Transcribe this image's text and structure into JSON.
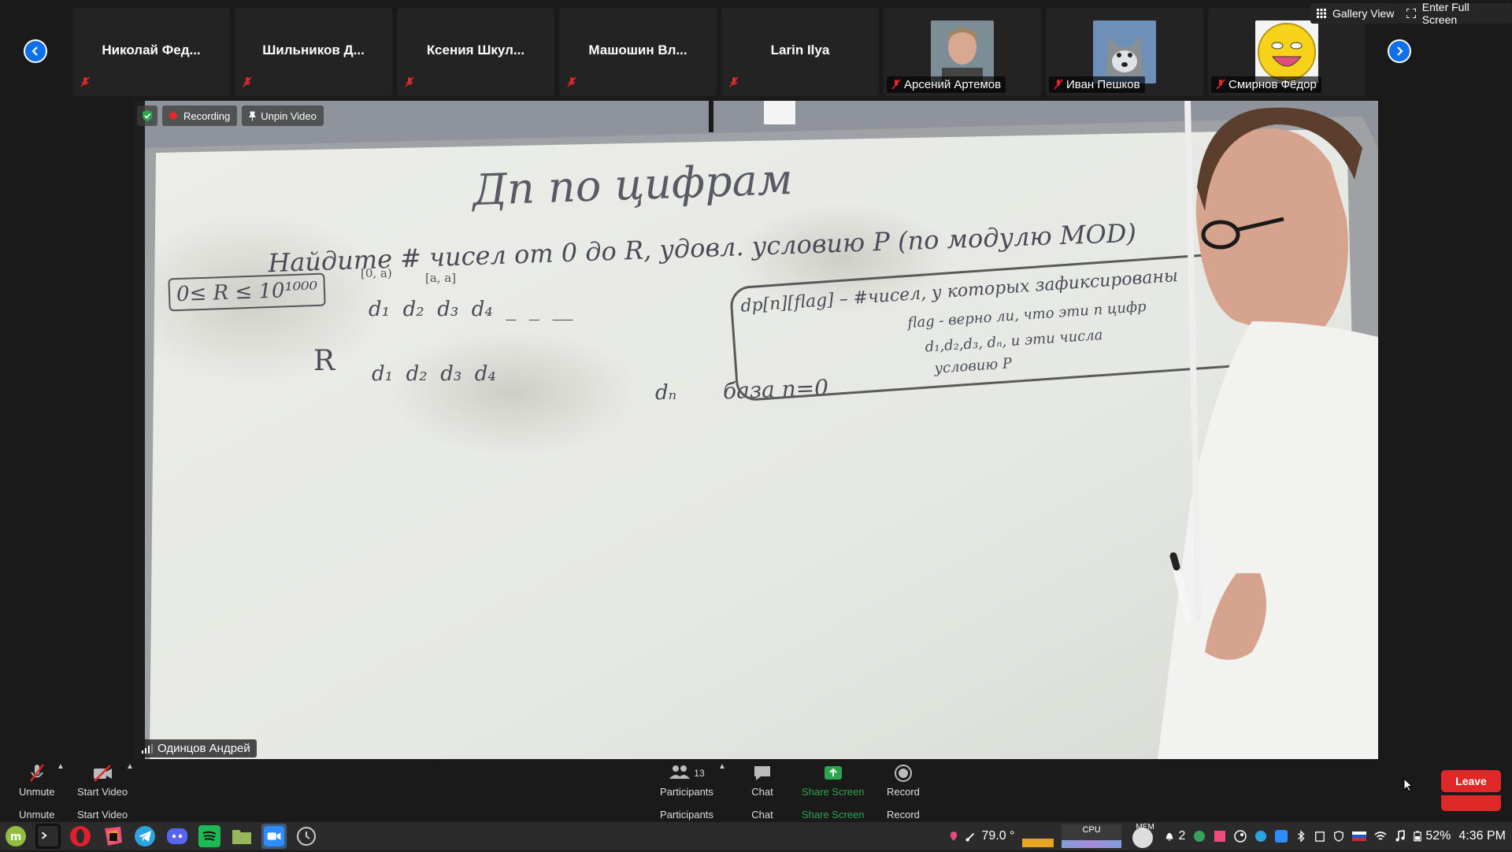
{
  "participants": [
    {
      "name": "Николай Фед..."
    },
    {
      "name": "Шильников Д..."
    },
    {
      "name": "Ксения Шкул..."
    },
    {
      "name": "Машошин Вл..."
    },
    {
      "name": "Larin Ilya"
    }
  ],
  "video_participants": [
    {
      "name": "Арсений Артемов"
    },
    {
      "name": "Иван Пешков"
    },
    {
      "name": "Смирнов Фёдор"
    }
  ],
  "top_controls": {
    "gallery_view": "Gallery View",
    "full_screen": "Enter Full Screen"
  },
  "video": {
    "recording": "Recording",
    "unpin": "Unpin Video",
    "speaker": "Одинцов Андрей"
  },
  "whiteboard": {
    "title": "Дп по цифрам",
    "line1": "Найдите # чисел от 0 до R, удовл. условию P (по модулю MOD)",
    "bound": "0≤ R ≤ 10¹⁰⁰⁰",
    "digits_top": "d₁  d₂  d₃  d₄  _  _  __",
    "idx1": "[0, a)",
    "idx2": "[a, a]",
    "row_R": "R",
    "digits_bottom": "d₁  d₂  d₃  d₄",
    "dn": "dₙ",
    "base": "база n=0",
    "dp_box1": "dp[n][flag] – #чисел, у которых зафиксированы",
    "dp_box2": "flag - верно ли, что эти n цифр",
    "dp_box3": "d₁,d₂,d₃, dₙ, и эти числа",
    "dp_box4": "условию P"
  },
  "toolbar": {
    "unmute": "Unmute",
    "start_video": "Start Video",
    "participants_count": "13",
    "participants": "Participants",
    "chat": "Chat",
    "share_screen": "Share Screen",
    "record": "Record",
    "leave": "Leave"
  },
  "tray": {
    "temperature": "79.0 °",
    "cpu": "CPU",
    "mem": "MEM",
    "notifications": "2",
    "battery": "52%",
    "time": "4:36 PM"
  },
  "colors": {
    "accent": "#0e71eb",
    "leave": "#e02828",
    "share": "#2da44e",
    "bg": "#1a1a1a"
  }
}
